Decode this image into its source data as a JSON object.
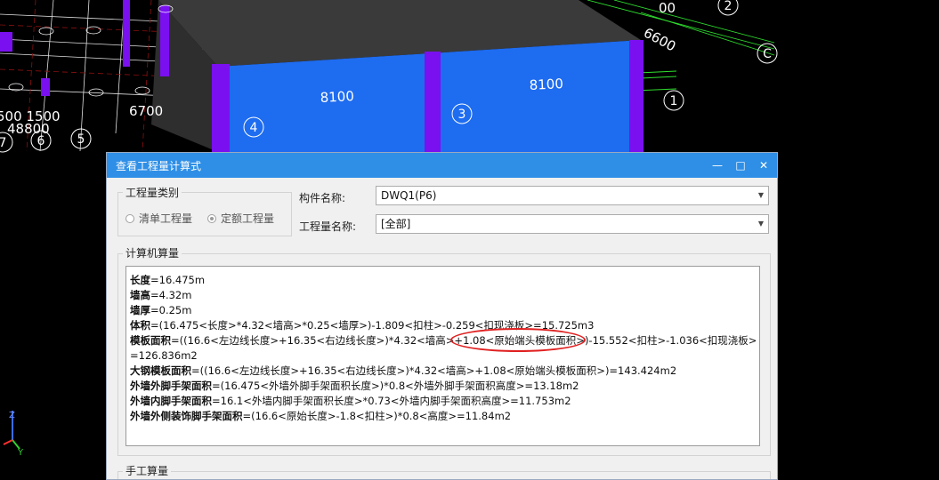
{
  "cad": {
    "dims": [
      "8100",
      "8100",
      "6700",
      "48800",
      "500 1500",
      "6600",
      "00"
    ],
    "axes": [
      "4",
      "3",
      "1",
      "C",
      "7",
      "6",
      "5",
      "2"
    ],
    "coord_axes": [
      "Z",
      "Y"
    ]
  },
  "dialog": {
    "title": "查看工程量计算式",
    "btn_min": "—",
    "btn_max": "□",
    "btn_close": "✕",
    "category_group_label": "工程量类别",
    "radio_list": "清单工程量",
    "radio_quota": "定额工程量",
    "radio_selected": "定额工程量",
    "component_label": "构件名称:",
    "component_value": "DWQ1(P6)",
    "qty_name_label": "工程量名称:",
    "qty_name_value": "[全部]",
    "computer_group_label": "计算机算量",
    "manual_group_label": "手工算量",
    "formulas": [
      {
        "name": "长度",
        "expr": "=16.475m"
      },
      {
        "name": "墙高",
        "expr": "=4.32m"
      },
      {
        "name": "墙厚",
        "expr": "=0.25m"
      },
      {
        "name": "体积",
        "expr": "=(16.475<长度>*4.32<墙高>*0.25<墙厚>)-1.809<扣柱>-0.259<扣现浇板>=15.725m3"
      },
      {
        "name": "模板面积",
        "expr": "=((16.6<左边线长度>+16.35<右边线长度>)*4.32<墙高>+1.08<原始端头模板面积>)-15.552<扣柱>-1.036<扣现浇板>"
      },
      {
        "name": "",
        "expr": "=126.836m2"
      },
      {
        "name": "大钢模板面积",
        "expr": "=((16.6<左边线长度>+16.35<右边线长度>)*4.32<墙高>+1.08<原始端头模板面积>)=143.424m2"
      },
      {
        "name": "外墙外脚手架面积",
        "expr": "=(16.475<外墙外脚手架面积长度>)*0.8<外墙外脚手架面积高度>=13.18m2"
      },
      {
        "name": "外墙内脚手架面积",
        "expr": "=16.1<外墙内脚手架面积长度>*0.73<外墙内脚手架面积高度>=11.753m2"
      },
      {
        "name": "外墙外侧装饰脚手架面积",
        "expr": "=(16.6<原始长度>-1.8<扣柱>)*0.8<高度>=11.84m2"
      }
    ]
  },
  "colors": {
    "titlebar": "#2f8fe6",
    "wall_blue": "#1e6cf0",
    "column_purple": "#7a10f0",
    "annotation_red": "#e02020"
  }
}
